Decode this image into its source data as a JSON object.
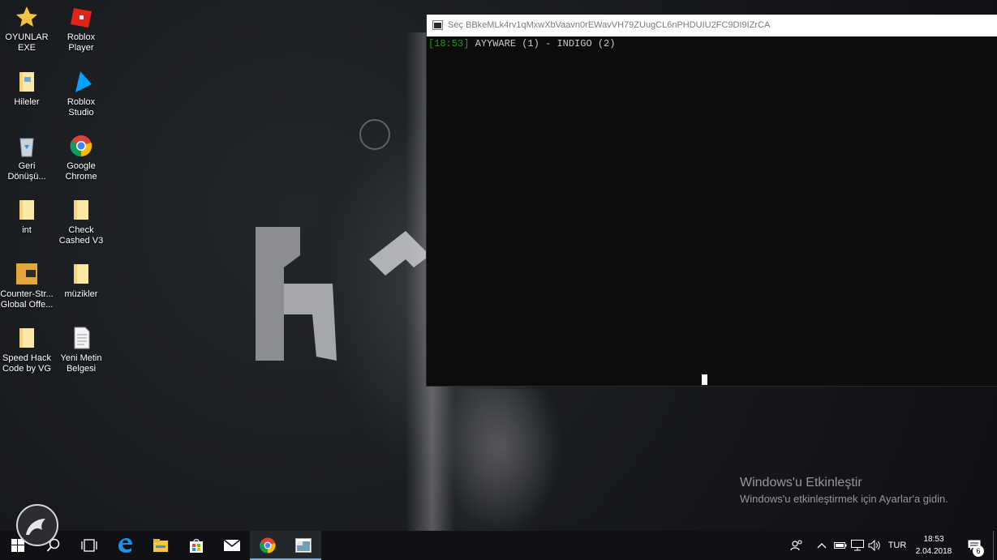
{
  "desktop": {
    "icons": [
      {
        "label": "OYUNLAR\nEXE",
        "icon": "star-shortcut-icon"
      },
      {
        "label": "Roblox Player",
        "icon": "roblox-player-icon"
      },
      {
        "label": "Hileler",
        "icon": "folder-icon"
      },
      {
        "label": "Roblox\nStudio",
        "icon": "roblox-studio-icon"
      },
      {
        "label": "Geri\nDönüşü...",
        "icon": "recycle-bin-icon"
      },
      {
        "label": "Google\nChrome",
        "icon": "chrome-icon"
      },
      {
        "label": "int",
        "icon": "folder-icon"
      },
      {
        "label": "Check\nCashed V3",
        "icon": "folder-icon"
      },
      {
        "label": "Counter-Str...\nGlobal Offe...",
        "icon": "csgo-icon"
      },
      {
        "label": "müzikler",
        "icon": "folder-icon"
      },
      {
        "label": "Speed Hack\nCode by VG",
        "icon": "folder-icon"
      },
      {
        "label": "Yeni Metin\nBelgesi",
        "icon": "text-document-icon"
      }
    ]
  },
  "console": {
    "title": "Seç BBkeMLk4rv1qMxwXbVaavn0rEWavVH79ZUugCL6nPHDUIU2FC9DI9IZrCA",
    "line": {
      "time": "[18:53]",
      "text": " AYYWARE (1) - INDIGO (2)"
    }
  },
  "activation": {
    "title": "Windows'u Etkinleştir",
    "subtitle": "Windows'u etkinleştirmek için Ayarlar'a gidin."
  },
  "taskbar": {
    "language": "TUR",
    "time": "18:53",
    "date": "2.04.2018",
    "notification_count": "6",
    "apps": [
      "start-icon",
      "search-icon",
      "task-view-icon",
      "edge-icon",
      "file-explorer-icon",
      "store-icon",
      "mail-icon",
      "chrome-icon",
      "console-app-icon"
    ]
  },
  "colors": {
    "console_bg": "#0c0c0c",
    "console_time": "#13a10e",
    "taskbar_bg": "#101114"
  }
}
